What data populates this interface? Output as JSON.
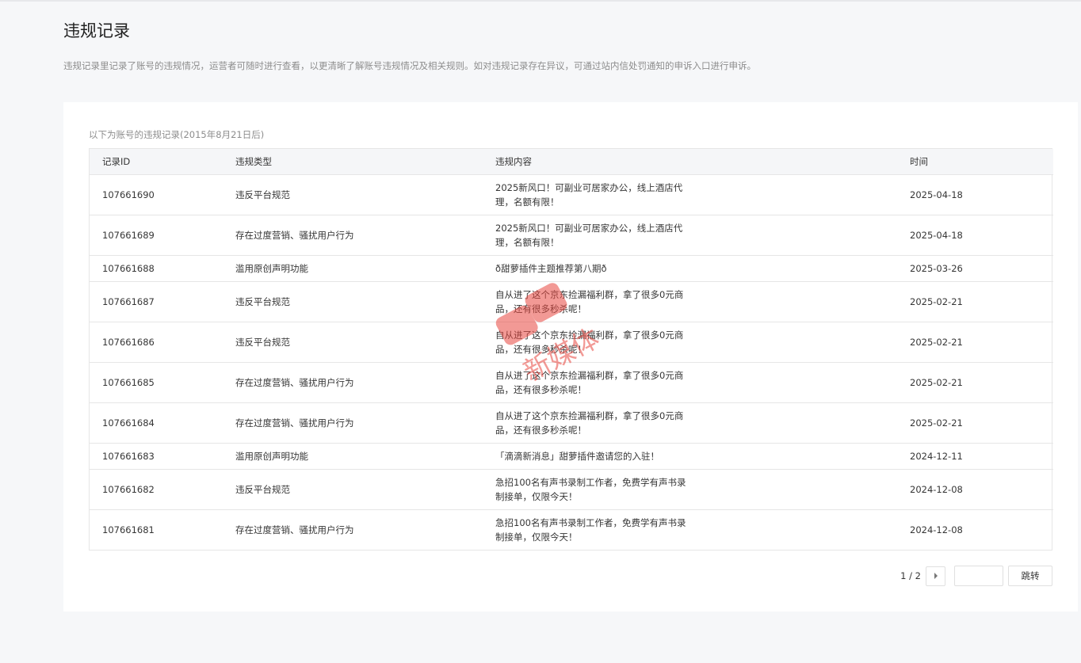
{
  "page": {
    "title": "违规记录",
    "description": "违规记录里记录了账号的违规情况，运营者可随时进行查看，以更清晰了解账号违规情况及相关规则。如对违规记录存在异议，可通过站内信处罚通知的申诉入口进行申诉。"
  },
  "records": {
    "subtitle": "以下为账号的违规记录(2015年8月21日后)",
    "columns": [
      "记录ID",
      "违规类型",
      "违规内容",
      "时间"
    ],
    "rows": [
      {
        "id": "107661690",
        "type": "违反平台规范",
        "content": "2025新风口！可副业可居家办公，线上酒店代理，名额有限！",
        "date": "2025-04-18"
      },
      {
        "id": "107661689",
        "type": "存在过度营销、骚扰用户行为",
        "content": "2025新风口！可副业可居家办公，线上酒店代理，名额有限！",
        "date": "2025-04-18"
      },
      {
        "id": "107661688",
        "type": "滥用原创声明功能",
        "content": "ð甜萝插件主题推荐第八期ð",
        "date": "2025-03-26"
      },
      {
        "id": "107661687",
        "type": "违反平台规范",
        "content": "自从进了这个京东捡漏福利群，拿了很多0元商品，还有很多秒杀呢！",
        "date": "2025-02-21"
      },
      {
        "id": "107661686",
        "type": "违反平台规范",
        "content": "自从进了这个京东捡漏福利群，拿了很多0元商品，还有很多秒杀呢！",
        "date": "2025-02-21"
      },
      {
        "id": "107661685",
        "type": "存在过度营销、骚扰用户行为",
        "content": "自从进了这个京东捡漏福利群，拿了很多0元商品，还有很多秒杀呢！",
        "date": "2025-02-21"
      },
      {
        "id": "107661684",
        "type": "存在过度营销、骚扰用户行为",
        "content": "自从进了这个京东捡漏福利群，拿了很多0元商品，还有很多秒杀呢！",
        "date": "2025-02-21"
      },
      {
        "id": "107661683",
        "type": "滥用原创声明功能",
        "content": "「滴滴新消息」甜萝插件邀请您的入驻！",
        "date": "2024-12-11"
      },
      {
        "id": "107661682",
        "type": "违反平台规范",
        "content": "急招100名有声书录制工作者，免费学有声书录制接单，仅限今天！",
        "date": "2024-12-08"
      },
      {
        "id": "107661681",
        "type": "存在过度营销、骚扰用户行为",
        "content": "急招100名有声书录制工作者，免费学有声书录制接单，仅限今天！",
        "date": "2024-12-08"
      }
    ]
  },
  "pagination": {
    "page_text": "1 / 2",
    "next_icon": "chevron-right-icon",
    "input_value": "",
    "jump_label": "跳转"
  },
  "watermark": {
    "text": "新媒体",
    "color": "#e8473f"
  }
}
